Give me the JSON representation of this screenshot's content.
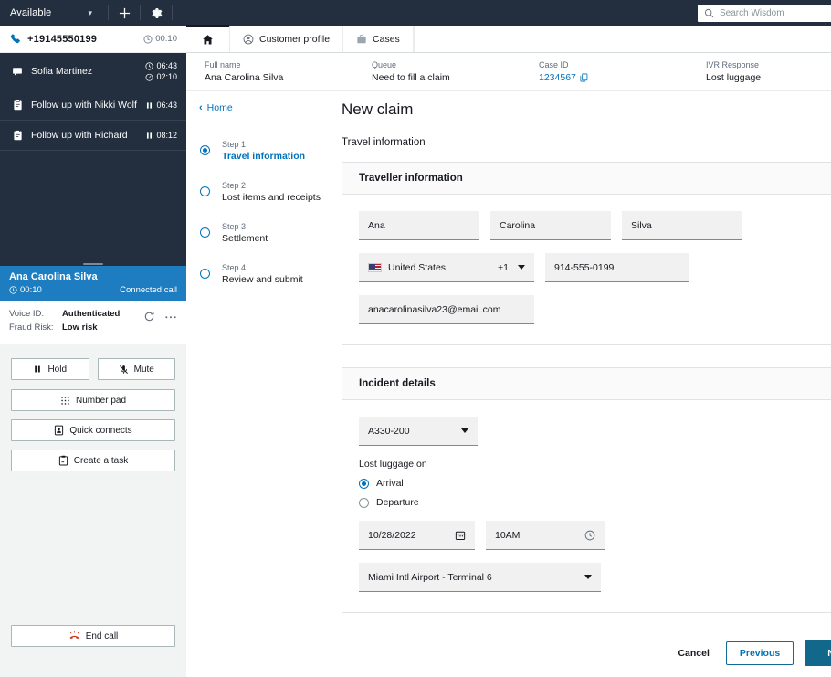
{
  "ccp": {
    "status": "Available",
    "status_caret": "chevron-down-icon",
    "add_label": "add-icon",
    "settings_label": "gear-icon",
    "active_call": {
      "number": "+19145550199",
      "duration": "00:10"
    },
    "contacts": [
      {
        "icon": "chat-icon",
        "label": "Sofia Martinez",
        "time1": "06:43",
        "time2": "02:10",
        "time1_icon": "clock-icon",
        "time2_icon": "stopwatch-icon"
      },
      {
        "icon": "task-icon",
        "label": "Follow up with Nikki Wolf",
        "time1": "06:43",
        "time1_icon": "pause-icon"
      },
      {
        "icon": "task-icon",
        "label": "Follow up with Richard",
        "time1": "08:12",
        "time1_icon": "pause-icon"
      }
    ],
    "connected": {
      "name": "Ana Carolina Silva",
      "duration": "00:10",
      "state": "Connected call"
    },
    "attributes": [
      {
        "key": "Voice ID:",
        "value": "Authenticated"
      },
      {
        "key": "Fraud Risk:",
        "value": "Low risk"
      }
    ],
    "actions": {
      "hold": "Hold",
      "mute": "Mute",
      "number_pad": "Number pad",
      "quick_connects": "Quick connects",
      "create_task": "Create a task",
      "end_call": "End call"
    }
  },
  "header": {
    "search_placeholder": "Search Wisdom",
    "search_value": "",
    "tabs": [
      {
        "name": "home",
        "label": "",
        "icon": "home-icon",
        "active": true
      },
      {
        "name": "customer-profile",
        "label": "Customer profile",
        "icon": "person-icon",
        "active": false
      },
      {
        "name": "cases",
        "label": "Cases",
        "icon": "briefcase-icon",
        "active": false
      }
    ]
  },
  "meta": [
    {
      "key": "Full name",
      "value": "Ana Carolina Silva",
      "link": false
    },
    {
      "key": "Queue",
      "value": "Need to fill a claim",
      "link": false
    },
    {
      "key": "Case ID",
      "value": "1234567",
      "link": true
    },
    {
      "key": "IVR Response",
      "value": "Lost luggage",
      "link": false
    }
  ],
  "wizard": {
    "back_link": "Home",
    "steps": [
      {
        "num": "Step 1",
        "label": "Travel information",
        "current": true
      },
      {
        "num": "Step 2",
        "label": "Lost items and receipts",
        "current": false
      },
      {
        "num": "Step 3",
        "label": "Settlement",
        "current": false
      },
      {
        "num": "Step 4",
        "label": "Review and submit",
        "current": false
      }
    ]
  },
  "form": {
    "page_title": "New claim",
    "section_title": "Travel information",
    "traveller": {
      "card_title": "Traveller information",
      "first_name": "Ana",
      "middle_name": "Carolina",
      "last_name": "Silva",
      "country": "United States",
      "country_code": "+1",
      "phone": "914-555-0199",
      "email": "anacarolinasilva23@email.com"
    },
    "incident": {
      "card_title": "Incident details",
      "aircraft": "A330-200",
      "radio_label": "Lost luggage on",
      "options": [
        {
          "label": "Arrival",
          "selected": true
        },
        {
          "label": "Departure",
          "selected": false
        }
      ],
      "date": "10/28/2022",
      "time": "10AM",
      "airport": "Miami Intl Airport  - Terminal 6"
    }
  },
  "footer": {
    "cancel": "Cancel",
    "previous": "Previous",
    "next": "Next"
  },
  "colors": {
    "dark": "#232f3e",
    "accent_blue": "#0073bb",
    "banner_blue": "#1d7dc0",
    "next_teal": "#12688a",
    "red": "#d13212"
  }
}
